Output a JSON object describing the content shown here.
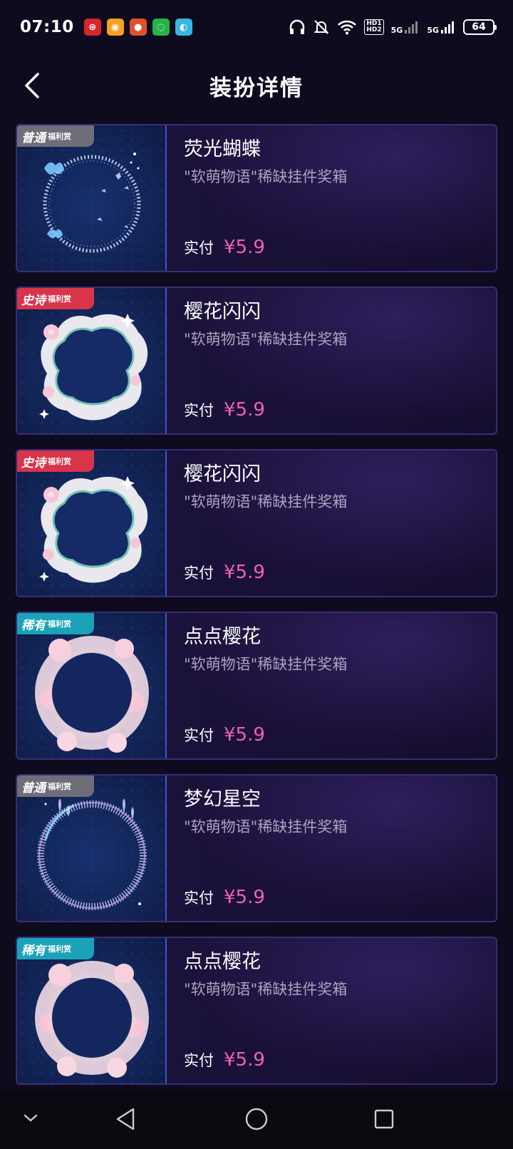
{
  "status": {
    "time": "07:10",
    "app_icons": [
      "news-app-icon",
      "weibo-icon",
      "game-app-icon",
      "wechat-icon",
      "messenger-icon"
    ],
    "signal1": "5G",
    "signal2": "5G",
    "hd1": "HD1",
    "hd2": "HD2",
    "battery": "64"
  },
  "header": {
    "title": "装扮详情"
  },
  "items": [
    {
      "badge": "普通",
      "badge_sub": "福利赏",
      "badge_color": "#6e6e78",
      "frame": "butterfly",
      "name": "荧光蝴蝶",
      "desc": "\"软萌物语\"稀缺挂件奖箱",
      "price_label": "实付",
      "price": "¥5.9"
    },
    {
      "badge": "史诗",
      "badge_sub": "福利赏",
      "badge_color": "#d8344a",
      "frame": "sakura-star",
      "name": "樱花闪闪",
      "desc": "\"软萌物语\"稀缺挂件奖箱",
      "price_label": "实付",
      "price": "¥5.9"
    },
    {
      "badge": "史诗",
      "badge_sub": "福利赏",
      "badge_color": "#d8344a",
      "frame": "sakura-star",
      "name": "樱花闪闪",
      "desc": "\"软萌物语\"稀缺挂件奖箱",
      "price_label": "实付",
      "price": "¥5.9"
    },
    {
      "badge": "稀有",
      "badge_sub": "福利赏",
      "badge_color": "#1aa3b8",
      "frame": "sakura-round",
      "name": "点点樱花",
      "desc": "\"软萌物语\"稀缺挂件奖箱",
      "price_label": "实付",
      "price": "¥5.9"
    },
    {
      "badge": "普通",
      "badge_sub": "福利赏",
      "badge_color": "#6e6e78",
      "frame": "starry",
      "name": "梦幻星空",
      "desc": "\"软萌物语\"稀缺挂件奖箱",
      "price_label": "实付",
      "price": "¥5.9"
    },
    {
      "badge": "稀有",
      "badge_sub": "福利赏",
      "badge_color": "#1aa3b8",
      "frame": "sakura-round",
      "name": "点点樱花",
      "desc": "\"软萌物语\"稀缺挂件奖箱",
      "price_label": "实付",
      "price": "¥5.9"
    }
  ],
  "colors": {
    "accent_price": "#f060b4",
    "background": "#0e0b1e",
    "card_border": "#3a2c78"
  }
}
